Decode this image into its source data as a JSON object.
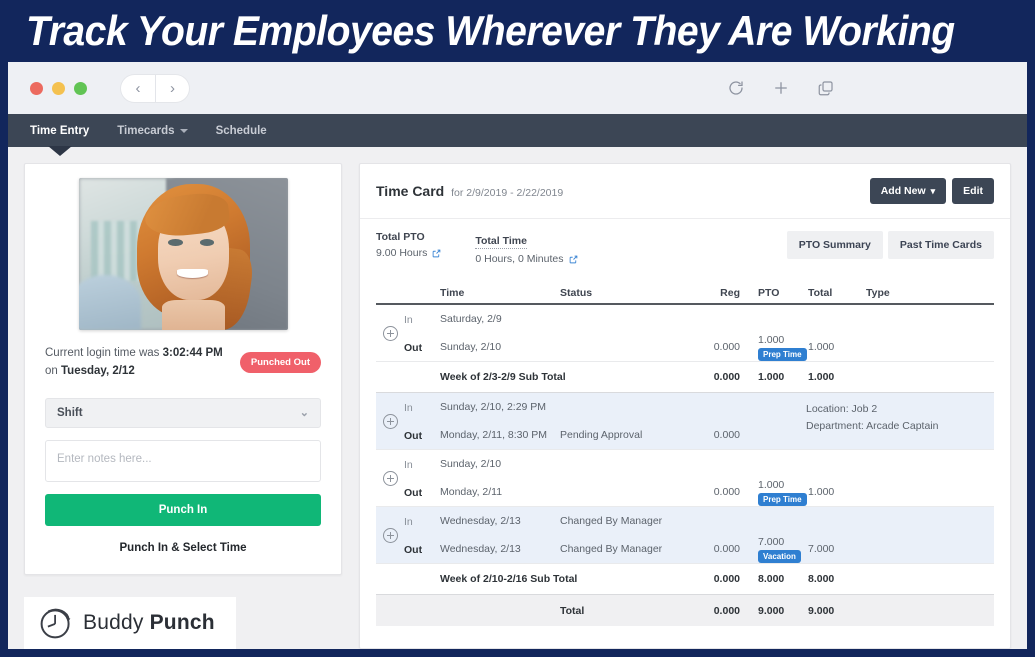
{
  "banner": {
    "headline": "Track Your Employees Wherever They Are Working"
  },
  "browser": {
    "nav_back_icon": "chevron-left-icon",
    "nav_forward_icon": "chevron-right-icon",
    "reload_icon": "reload-icon",
    "new_tab_icon": "plus-icon",
    "tabs_icon": "duplicate-tabs-icon"
  },
  "appnav": {
    "items": [
      {
        "label": "Time Entry",
        "active": true,
        "has_caret": false
      },
      {
        "label": "Timecards",
        "active": false,
        "has_caret": true
      },
      {
        "label": "Schedule",
        "active": false,
        "has_caret": false
      }
    ]
  },
  "punch_card": {
    "login_prefix": "Current login time was ",
    "login_time": "3:02:44 PM",
    "login_on": "on ",
    "login_day": "Tuesday, 2/12",
    "status_badge": "Punched Out",
    "shift_select_value": "Shift",
    "notes_placeholder": "Enter notes here...",
    "punch_in_label": "Punch In",
    "punch_in_select_label": "Punch In & Select Time"
  },
  "logo": {
    "word_light": "Buddy",
    "word_bold": "Punch",
    "mark_icon": "clock-arrow-icon"
  },
  "time_card": {
    "title": "Time Card",
    "range": "for 2/9/2019 - 2/22/2019",
    "add_new_label": "Add New",
    "edit_label": "Edit",
    "pto_summary_label": "PTO Summary",
    "past_time_cards_label": "Past Time Cards",
    "stats": [
      {
        "label": "Total PTO",
        "value": "9.00 Hours",
        "dotted": false
      },
      {
        "label": "Total Time",
        "value": "0 Hours, 0 Minutes",
        "dotted": true
      }
    ],
    "columns": {
      "time": "Time",
      "status": "Status",
      "reg": "Reg",
      "pto": "PTO",
      "total": "Total",
      "type": "Type"
    },
    "entries": [
      {
        "highlight": false,
        "in": {
          "io": "In",
          "time": "Saturday, 2/9",
          "status": "",
          "reg": "",
          "pto": "",
          "total": "",
          "badge": ""
        },
        "out": {
          "io": "Out",
          "time": "Sunday, 2/10",
          "status": "",
          "reg": "0.000",
          "pto": "1.000",
          "total": "1.000",
          "badge": "Prep Time"
        },
        "type_lines": []
      },
      {
        "highlight": false,
        "subtotal": {
          "label": "Week of 2/3-2/9 Sub Total",
          "reg": "0.000",
          "pto": "1.000",
          "total": "1.000"
        }
      },
      {
        "highlight": true,
        "in": {
          "io": "In",
          "time": "Sunday, 2/10, 2:29 PM",
          "status": "",
          "reg": "",
          "pto": "",
          "total": "",
          "badge": ""
        },
        "out": {
          "io": "Out",
          "time": "Monday, 2/11, 8:30 PM",
          "status": "Pending Approval",
          "reg": "0.000",
          "pto": "",
          "total": "",
          "badge": ""
        },
        "type_lines": [
          "Location: Job 2",
          "Department: Arcade Captain"
        ]
      },
      {
        "highlight": false,
        "in": {
          "io": "In",
          "time": "Sunday, 2/10",
          "status": "",
          "reg": "",
          "pto": "",
          "total": "",
          "badge": ""
        },
        "out": {
          "io": "Out",
          "time": "Monday, 2/11",
          "status": "",
          "reg": "0.000",
          "pto": "1.000",
          "total": "1.000",
          "badge": "Prep Time"
        },
        "type_lines": []
      },
      {
        "highlight": true,
        "in": {
          "io": "In",
          "time": "Wednesday, 2/13",
          "status": "Changed By Manager",
          "reg": "",
          "pto": "",
          "total": "",
          "badge": ""
        },
        "out": {
          "io": "Out",
          "time": "Wednesday, 2/13",
          "status": "Changed By Manager",
          "reg": "0.000",
          "pto": "7.000",
          "total": "7.000",
          "badge": "Vacation"
        },
        "type_lines": []
      },
      {
        "highlight": false,
        "subtotal": {
          "label": "Week of 2/10-2/16 Sub Total",
          "reg": "0.000",
          "pto": "8.000",
          "total": "8.000"
        }
      }
    ],
    "grand_total": {
      "label": "Total",
      "reg": "0.000",
      "pto": "9.000",
      "total": "9.000"
    }
  },
  "colors": {
    "frame_navy": "#12265c",
    "app_nav": "#3c4655",
    "punch_green": "#10b777",
    "badge_red": "#f0606a",
    "badge_blue": "#2f7fd1",
    "row_highlight": "#eaf0f9"
  }
}
